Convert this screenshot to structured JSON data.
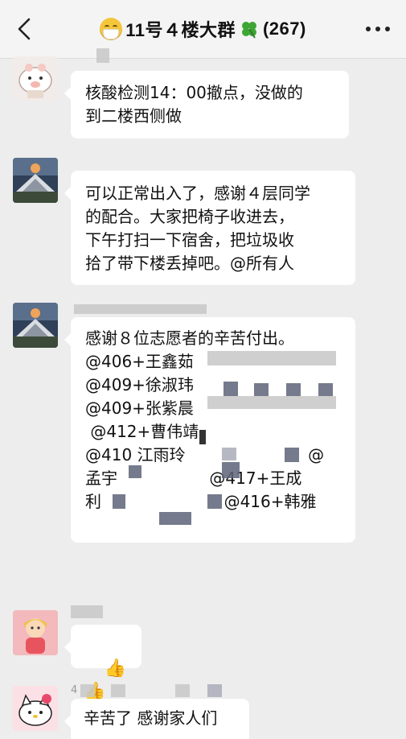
{
  "header": {
    "title": "11号４楼大群",
    "count": "(267)",
    "back_icon": "chevron-left-icon",
    "more_icon": "more-dots-icon"
  },
  "messages": [
    {
      "avatar": "pig-avatar",
      "sender": "",
      "text": "核酸检测14：00撤点，没做的\n到二楼西侧做"
    },
    {
      "avatar": "mountain-avatar",
      "sender": "",
      "text": "可以正常出入了，感谢４层同学\n的配合。大家把椅子收进去，\n下午打扫一下宿舍，把垃圾收\n拾了带下楼丢掉吧。@所有人"
    },
    {
      "avatar": "mountain-avatar",
      "sender": "",
      "text": "感谢８位志愿者的辛苦付出。\n@406+王鑫茹\n@409+徐淑玮\n@409+张紫晨\n @412+曹伟靖\n@410 江雨玲                        @\n孟宇                  @417+王成\n利                        @416+韩雅"
    },
    {
      "avatar": "girl-avatar",
      "sender": "",
      "text": "👍👍"
    },
    {
      "avatar": "kitty-avatar",
      "sender": "4",
      "text": "辛苦了 感谢家人们"
    }
  ],
  "colors": {
    "background": "#ededed",
    "bubble": "#ffffff",
    "header": "#f4f4f4"
  }
}
